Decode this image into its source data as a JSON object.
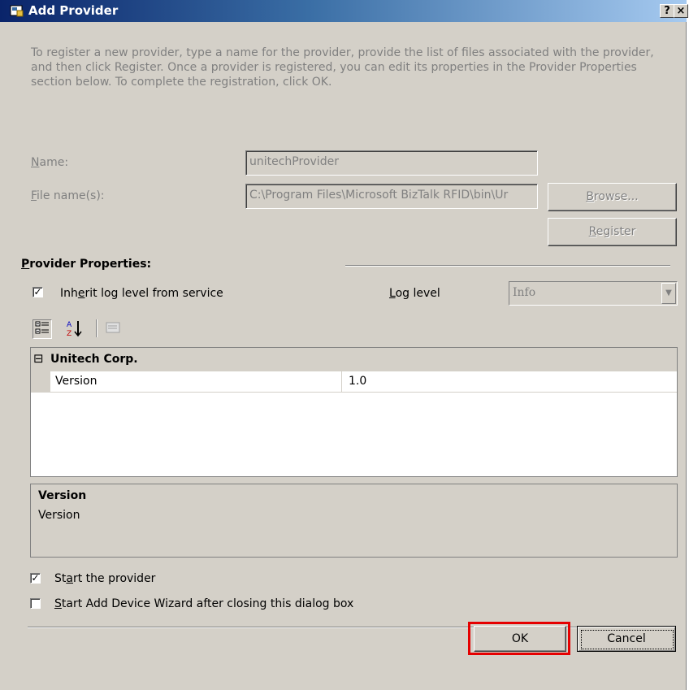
{
  "window": {
    "title": "Add Provider",
    "help_button": "?",
    "close_button": "×"
  },
  "intro_text": "To register a new provider, type a name for the provider, provide the list of files associated with the provider, and then click Register. Once a provider is registered, you can edit its properties in the Provider Properties section below. To complete the registration, click OK.",
  "form": {
    "name_label": {
      "underlined": "N",
      "rest": "ame:"
    },
    "name_value": "unitechProvider",
    "files_label": {
      "underlined": "F",
      "rest": "ile name(s):"
    },
    "files_value": "C:\\Program Files\\Microsoft BizTalk RFID\\bin\\Ur",
    "browse_button": {
      "underlined": "B",
      "rest": "rowse..."
    },
    "register_button": {
      "underlined": "R",
      "rest": "egister"
    }
  },
  "provider_properties": {
    "title": {
      "underlined": "P",
      "rest": "rovider Properties:"
    },
    "inherit_checkbox": {
      "checked": true,
      "pre": "Inh",
      "underlined": "e",
      "post": "rit log level from service"
    },
    "log_level_label": {
      "underlined": "L",
      "rest": "og level"
    },
    "log_level_value": "Info",
    "toolbar_icons": [
      "categorized-icon",
      "alphabetical-sort-icon",
      "property-pages-icon"
    ],
    "grid": {
      "category": "Unitech Corp.",
      "expander": "⊟",
      "rows": [
        {
          "name": "Version",
          "value": "1.0"
        }
      ]
    },
    "description": {
      "title": "Version",
      "text": "Version"
    }
  },
  "options": {
    "start_provider": {
      "checked": true,
      "pre": "St",
      "underlined": "a",
      "post": "rt the provider"
    },
    "start_wizard": {
      "checked": false,
      "underlined": "S",
      "post": "tart Add Device Wizard after closing this dialog box"
    }
  },
  "buttons": {
    "ok": "OK",
    "cancel": "Cancel"
  },
  "colors": {
    "highlight": "#e50000",
    "titlebar": "#0a246a",
    "dialog_bg": "#d4d0c8"
  }
}
